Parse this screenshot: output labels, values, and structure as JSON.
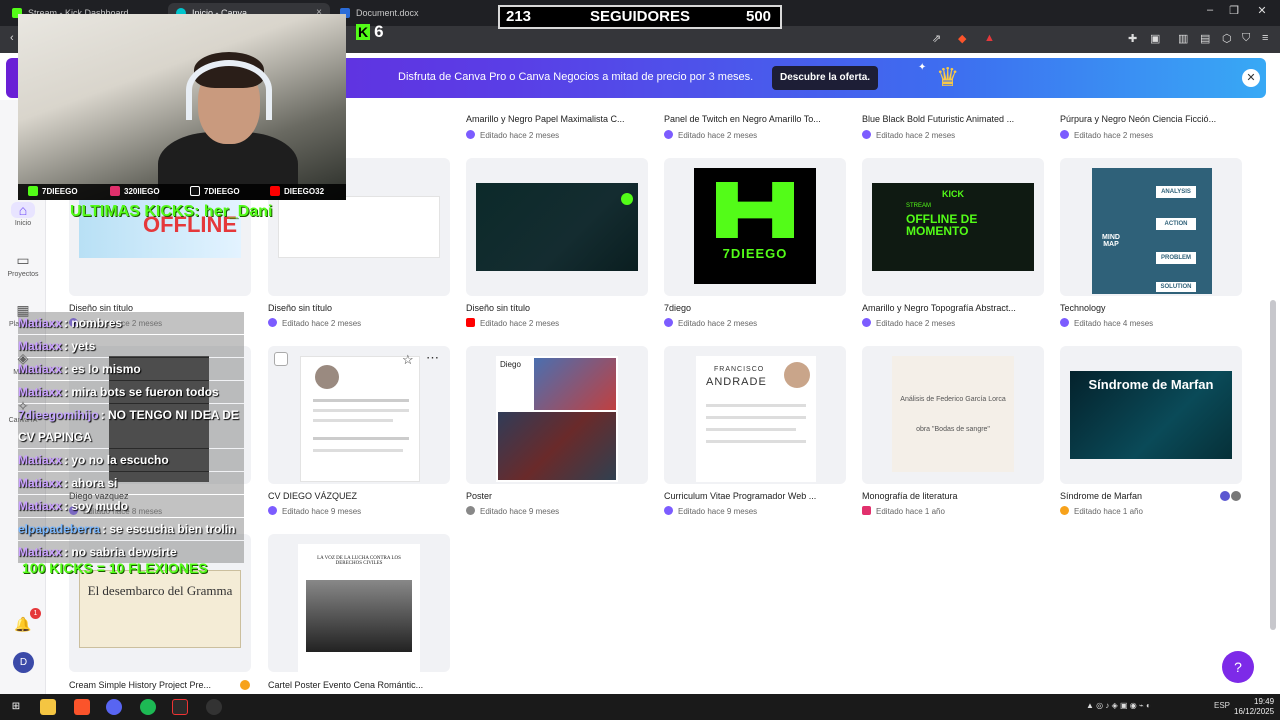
{
  "browser": {
    "tabs": [
      {
        "label": "Stream - Kick Dashboard"
      },
      {
        "label": "Inicio - Canva"
      },
      {
        "label": "Document.docx"
      }
    ],
    "close_glyph": "×",
    "window_controls": [
      "–",
      "❐",
      "✕"
    ]
  },
  "stream_overlay": {
    "followers_current": "213",
    "followers_label": "SEGUIDORES",
    "followers_goal": "500",
    "kick_viewers": "6",
    "kick_logo_letter": "K",
    "socials": [
      "7DIEEGO",
      "320IIEGO",
      "7DIEEGO",
      "DIEEGO32"
    ],
    "last_kicks": "ULTIMAS KICKS: her_Dani",
    "push_goal": "100 KICKS = 10 FLEXIONES",
    "chat": [
      {
        "user": "Matiaxx",
        "text": ": nombres"
      },
      {
        "user": "Matiaxx",
        "text": ": yets"
      },
      {
        "user": "Matiaxx",
        "text": ": es lo mismo"
      },
      {
        "user": "Matiaxx",
        "text": ": mira bots se fueron todos"
      },
      {
        "user": "7dieegomihijo",
        "text": ": NO TENGO NI IDEA DE CV PAPINGA"
      },
      {
        "user": "Matiaxx",
        "text": ": yo no la escucho"
      },
      {
        "user": "Matiaxx",
        "text": ": ahora si"
      },
      {
        "user": "Matiaxx",
        "text": ": soy mudo"
      },
      {
        "user": "elpapadeberra",
        "text": ": se escucha bien trolin"
      },
      {
        "user": "Matiaxx",
        "text": ": no sabria dewcirte"
      }
    ]
  },
  "banner": {
    "text": "Disfruta de Canva Pro o Canva Negocios a mitad de precio por 3 meses.",
    "cta": "Descubre la oferta.",
    "close": "✕"
  },
  "rail": {
    "items": [
      {
        "label": "Inicio",
        "icon": "home-icon"
      },
      {
        "label": "Proyectos",
        "icon": "folder-icon"
      },
      {
        "label": "Plantillas",
        "icon": "template-icon"
      },
      {
        "label": "Marca",
        "icon": "brand-icon"
      },
      {
        "label": "Canva IA",
        "icon": "ai-icon"
      }
    ],
    "notifications": "1",
    "avatar": "D"
  },
  "designs_top_row": [
    {
      "title": "Amarillo y Negro Papel Maximalista C...",
      "meta": "Editado hace 2 meses"
    },
    {
      "title": "Panel de Twitch en Negro Amarillo To...",
      "meta": "Editado hace 2 meses"
    },
    {
      "title": "Blue Black Bold Futuristic Animated ...",
      "meta": "Editado hace 2 meses"
    },
    {
      "title": "Púrpura y Negro Neón Ciencia Ficció...",
      "meta": "Editado hace 2 meses"
    }
  ],
  "designs_row1": [
    {
      "title": "Diseño sin título",
      "meta": "Editado hace 2 meses",
      "thumb_text": "OFFLINE"
    },
    {
      "title": "Diseño sin título",
      "meta": "Editado hace 2 meses"
    },
    {
      "title": "Diseño sin título",
      "meta": "Editado hace 2 meses"
    },
    {
      "title": "7diego",
      "meta": "Editado hace 2 meses",
      "thumb_text": "7DIEEGO"
    },
    {
      "title": "Amarillo y Negro Topografía Abstract...",
      "meta": "Editado hace 2 meses",
      "thumb_kick": "KICK",
      "thumb_stream": "STREAM",
      "thumb_text": "OFFLINE DE MOMENTO"
    },
    {
      "title": "Technology",
      "meta": "Editado hace 4 meses",
      "thumb_text": "MIND MAP",
      "thumb_steps": [
        "ANALYSIS",
        "ACTION",
        "PROBLEM",
        "SOLUTION"
      ]
    }
  ],
  "designs_row2": [
    {
      "title": "Diego vazquez",
      "meta": "Editado hace 8 meses"
    },
    {
      "title": "CV DIEGO VÁZQUEZ",
      "meta": "Editado hace 9 meses"
    },
    {
      "title": "Poster",
      "meta": "Editado hace 9 meses",
      "thumb_text": "Diego"
    },
    {
      "title": "Curriculum Vitae Programador Web ...",
      "meta": "Editado hace 9 meses",
      "thumb_name": "FRANCISCO",
      "thumb_surname": "ANDRADE"
    },
    {
      "title": "Monografía de literatura",
      "meta": "Editado hace 1 año",
      "thumb_text": "Análisis de Federico García Lorca",
      "thumb_sub": "obra \"Bodas de sangre\""
    },
    {
      "title": "Síndrome de Marfan",
      "meta": "Editado hace 1 año",
      "thumb_text": "Síndrome de Marfan"
    }
  ],
  "designs_row3": [
    {
      "title": "Cream Simple History Project Pre...",
      "thumb_text": "El desembarco del Gramma"
    },
    {
      "title": "Cartel Poster Evento Cena Romántic...",
      "thumb_text": "LA VOZ DE LA LUCHA CONTRA LOS DERECHOS CIVILES"
    }
  ],
  "help": "?",
  "taskbar": {
    "time": "19:49",
    "date": "16/12/2025",
    "lang": "ESP"
  },
  "colors": {
    "canva_purple": "#7d2ae8",
    "kick_green": "#53fc18",
    "banner_start": "#6a1fd6",
    "banner_end": "#38a9f5"
  }
}
